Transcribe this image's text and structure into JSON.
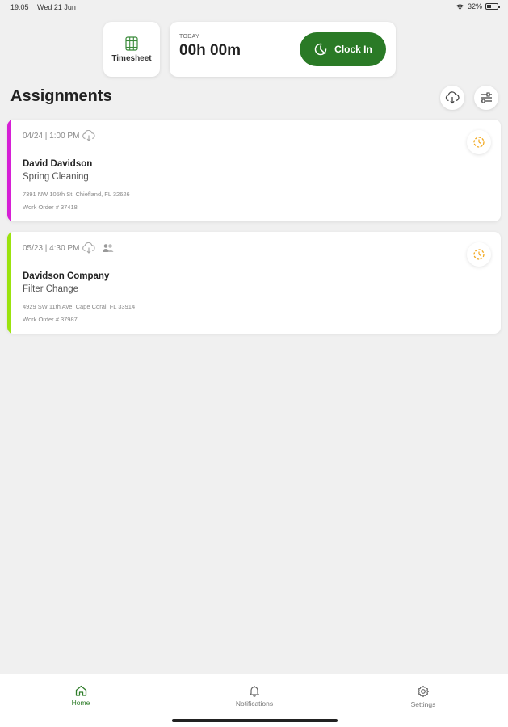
{
  "status_bar": {
    "time": "19:05",
    "date": "Wed 21 Jun",
    "battery": "32%"
  },
  "timesheet": {
    "label": "Timesheet",
    "icon": "table-icon"
  },
  "today": {
    "label": "TODAY",
    "time": "00h 00m"
  },
  "clock_in": {
    "label": "Clock In",
    "color": "#2a7a26"
  },
  "page": {
    "title": "Assignments"
  },
  "assignments": [
    {
      "meta": "04/24 | 1:00 PM",
      "name": "David Davidson",
      "job": "Spring Cleaning",
      "address": "7391 NW 105th St, Chiefland, FL  32626",
      "work_order": "Work Order # 37418",
      "stripe_color": "#d620d6"
    },
    {
      "meta": "05/23 | 4:30 PM",
      "name": "Davidson Company",
      "job": "Filter Change",
      "address": "4929 SW 11th Ave, Cape Coral, FL  33914",
      "work_order": "Work Order # 37987",
      "stripe_color": "#9be30e"
    }
  ],
  "nav": {
    "home": "Home",
    "notifications": "Notifications",
    "settings": "Settings"
  }
}
